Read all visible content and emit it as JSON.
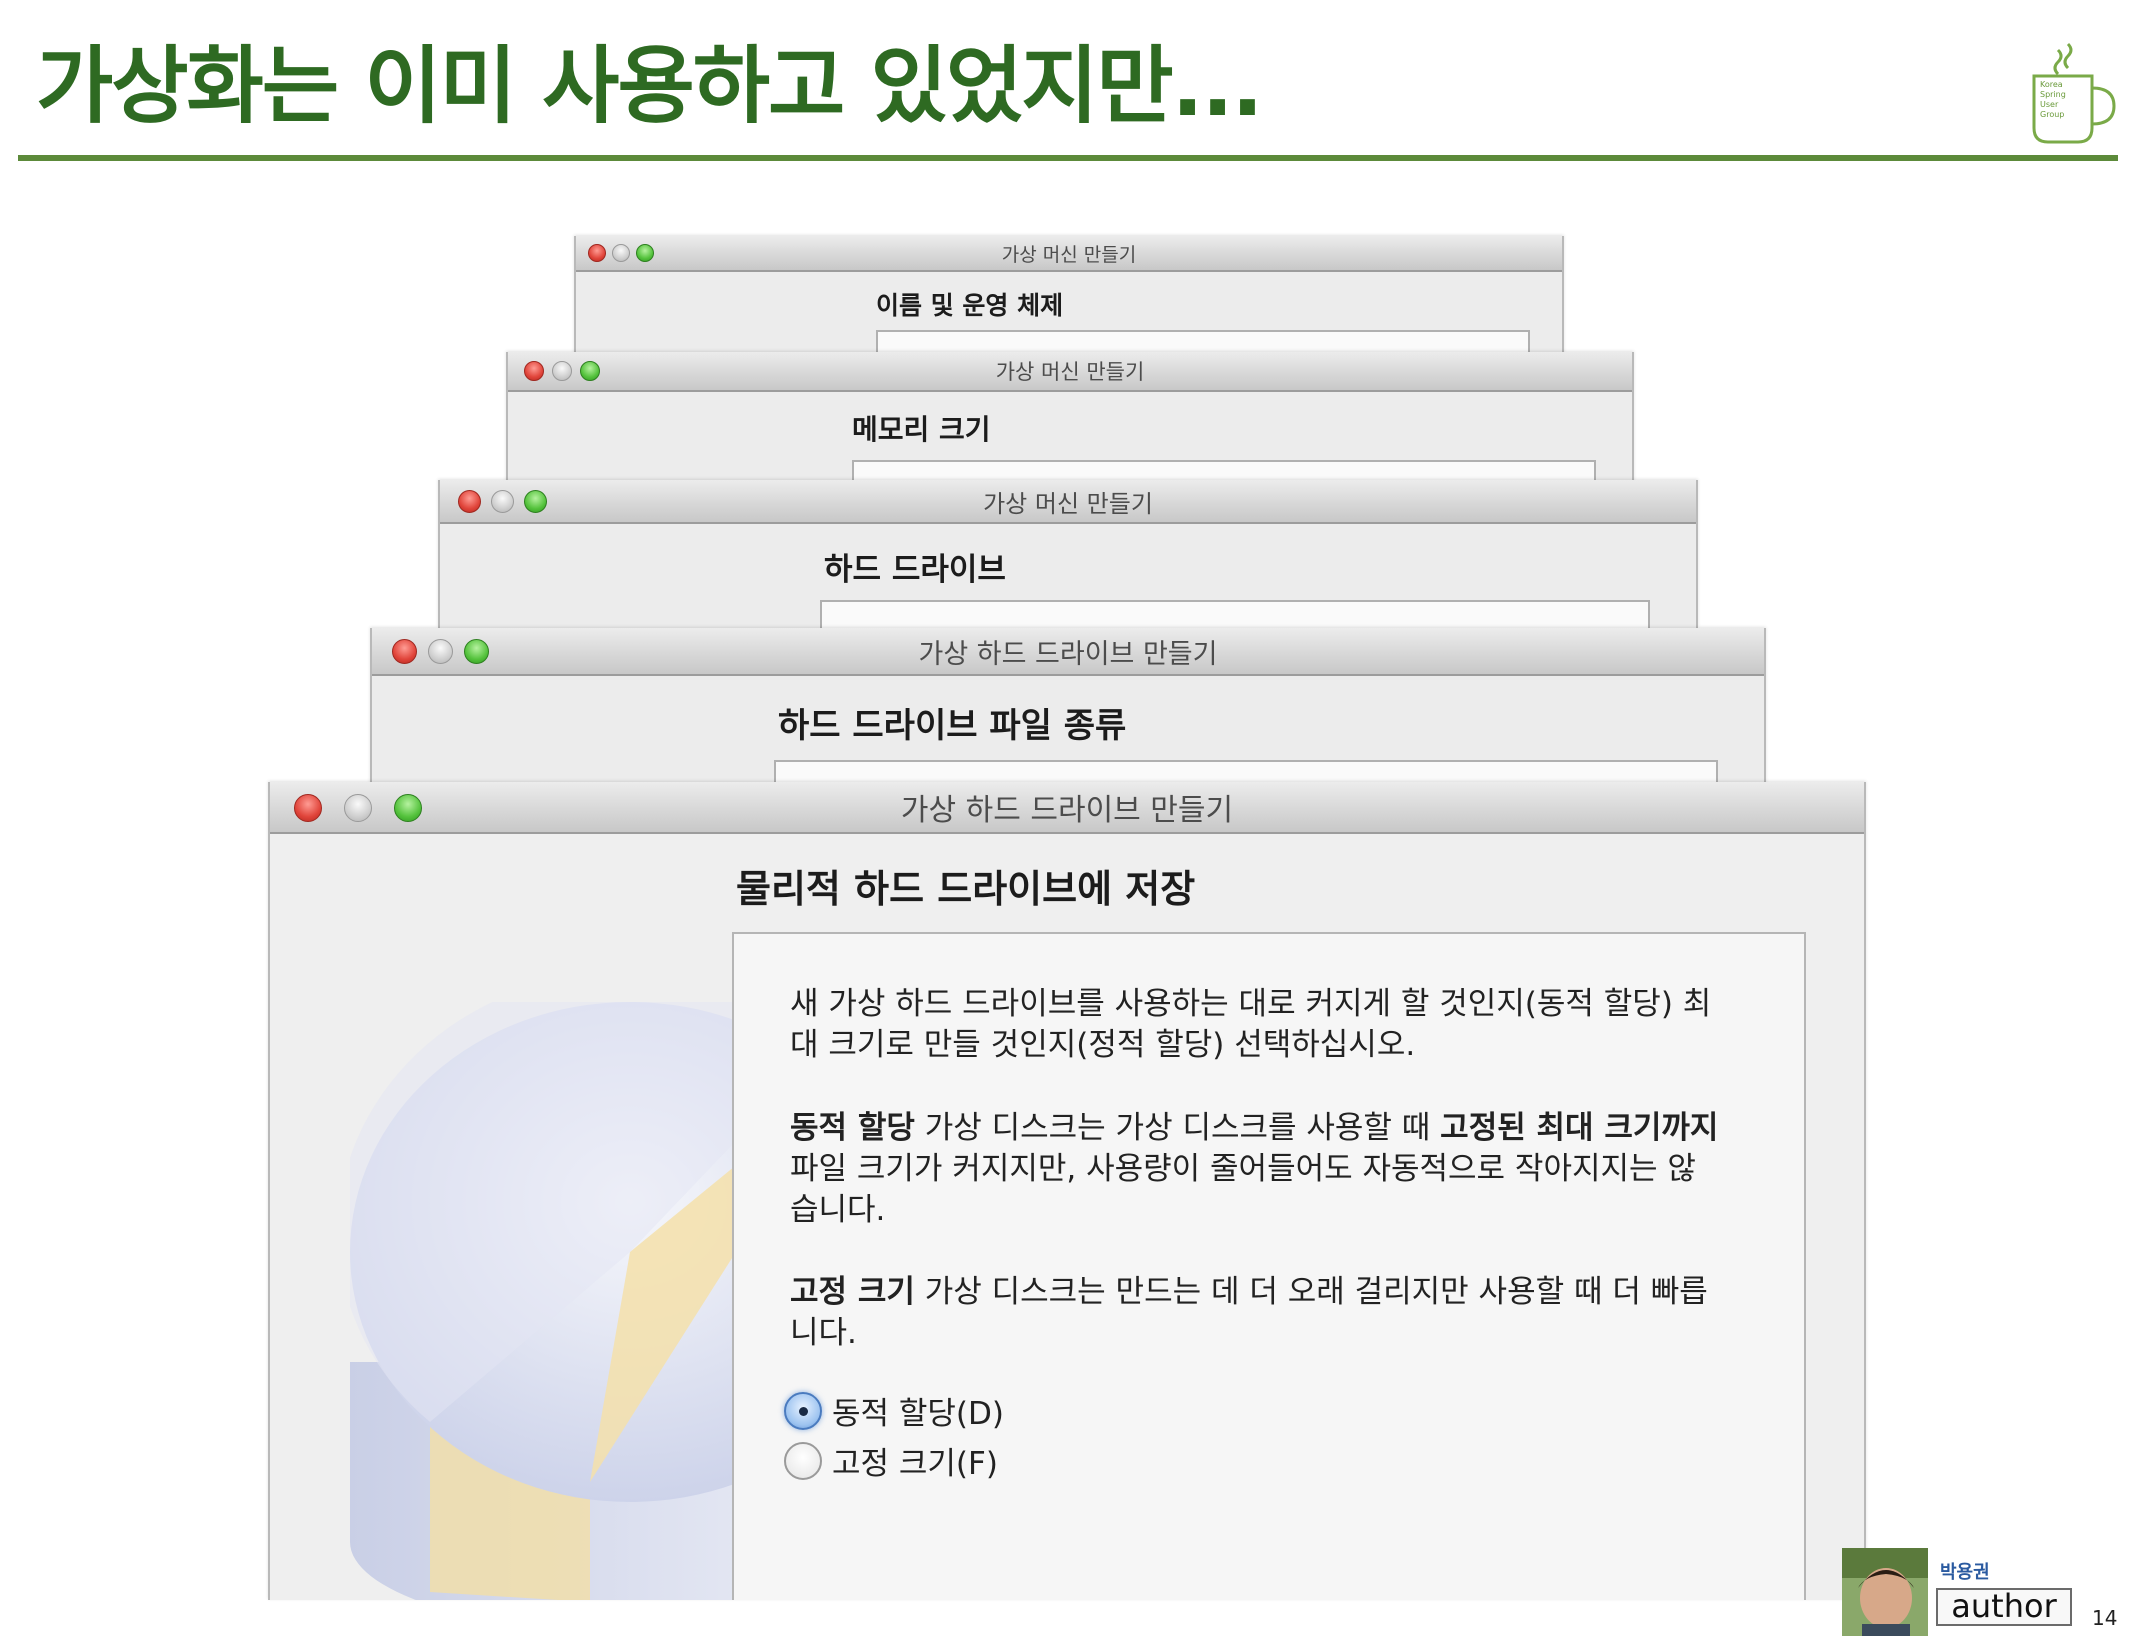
{
  "slide": {
    "title": "가상화는 이미 사용하고 있었지만...",
    "page_number": "14",
    "logo_lines": [
      "Korea",
      "Spring",
      "User",
      "Group"
    ]
  },
  "windows": [
    {
      "title": "가상 머신 만들기",
      "heading": "이름 및 운영 체제"
    },
    {
      "title": "가상 머신 만들기",
      "heading": "메모리 크기"
    },
    {
      "title": "가상 머신 만들기",
      "heading": "하드 드라이브"
    },
    {
      "title": "가상 하드 드라이브 만들기",
      "heading": "하드 드라이브 파일 종류"
    },
    {
      "title": "가상 하드 드라이브 만들기",
      "heading": "물리적 하드 드라이브에 저장",
      "intro": "새 가상 하드 드라이브를 사용하는 대로 커지게 할 것인지(동적 할당) 최대 크기로 만들 것인지(정적 할당) 선택하십시오.",
      "dynamic_desc": {
        "bold1": "동적 할당",
        "text1": " 가상 디스크는 가상 디스크를 사용할 때 ",
        "bold2": "고정된 최대 크기까지",
        "text2": " 파일 크기가 커지지만, 사용량이 줄어들어도 자동적으로 작아지지는 않습니다."
      },
      "fixed_desc": {
        "bold1": "고정 크기",
        "text1": " 가상 디스크는 만드는 데 더 오래 걸리지만 사용할 때 더 빠릅니다."
      },
      "options": [
        {
          "label": "동적 할당(D)",
          "selected": true
        },
        {
          "label": "고정 크기(F)",
          "selected": false
        }
      ]
    }
  ],
  "author": {
    "name": "박용권",
    "badge": "author"
  },
  "colors": {
    "title_green": "#2e6a22",
    "rule_green": "#5c8a3a",
    "close": "#e0443a",
    "zoom": "#54c23c",
    "radio_selected": "#5f92d4"
  }
}
